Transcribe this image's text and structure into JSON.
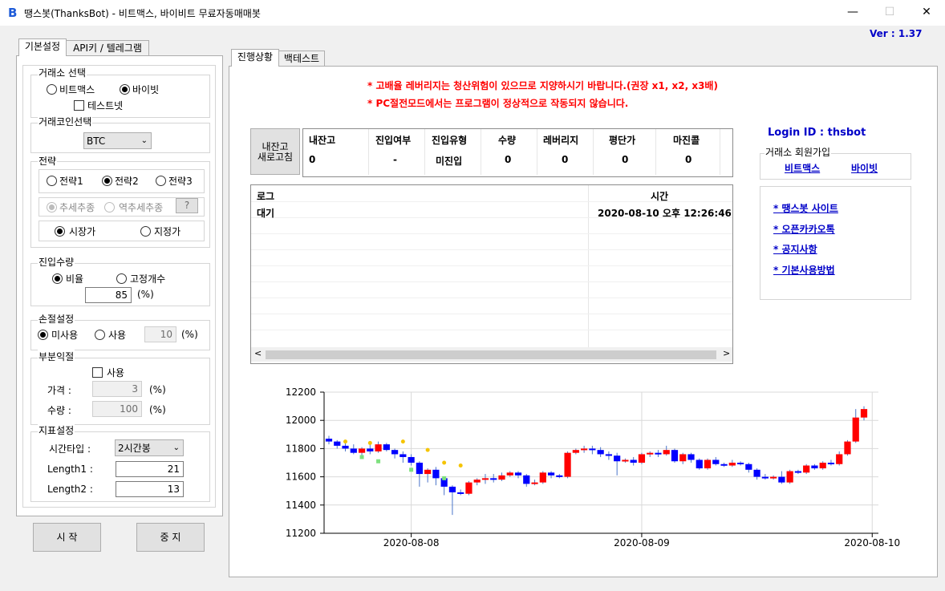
{
  "window": {
    "title": "땡스봇(ThanksBot) - 비트맥스, 바이비트 무료자동매매봇",
    "app_icon": "B",
    "minimize_glyph": "—",
    "maximize_glyph": "☐",
    "close_glyph": "✕",
    "version": "Ver :  1.37"
  },
  "left_tabs": [
    "기본설정",
    "API키 / 텔레그램"
  ],
  "exchange": {
    "title": "거래소 선택",
    "options": [
      "비트맥스",
      "바이빗"
    ],
    "selected": 1,
    "testnet_label": "테스트넷",
    "testnet_checked": false
  },
  "coin": {
    "title": "거래코인선택",
    "value": "BTC"
  },
  "strategy": {
    "title": "전략",
    "options": [
      "전략1",
      "전략2",
      "전략3"
    ],
    "selected": 1,
    "trend_options": [
      "추세추종",
      "역추세추종"
    ],
    "trend_selected": 0,
    "help_label": "?",
    "order_options": [
      "시장가",
      "지정가"
    ],
    "order_selected": 0
  },
  "entry_qty": {
    "title": "진입수량",
    "options": [
      "비율",
      "고정개수"
    ],
    "selected": 0,
    "value": "85",
    "unit": "(%)"
  },
  "stoploss": {
    "title": "손절설정",
    "options": [
      "미사용",
      "사용"
    ],
    "selected": 0,
    "value": "10",
    "unit": "(%)"
  },
  "partial": {
    "title": "부분익절",
    "use_label": "사용",
    "use_checked": false,
    "price_label": "가격 :",
    "price_value": "3",
    "qty_label": "수량 :",
    "qty_value": "100",
    "unit": "(%)"
  },
  "indicator": {
    "title": "지표설정",
    "timeframe_label": "시간타입 :",
    "timeframe_value": "2시간봉",
    "length1_label": "Length1 :",
    "length1_value": "21",
    "length2_label": "Length2 :",
    "length2_value": "13"
  },
  "buttons": {
    "start": "시 작",
    "stop": "중 지"
  },
  "right_tabs": [
    "진행상황",
    "백테스트"
  ],
  "warnings": [
    "* 고배율 레버리지는 청산위험이 있으므로 지양하시기 바랍니다.(권장 x1, x2, x3배)",
    "* PC절전모드에서는 프로그램이 정상적으로 작동되지 않습니다."
  ],
  "refresh_button": [
    "내잔고",
    "새로고침"
  ],
  "status_table": {
    "headers": [
      "내잔고",
      "진입여부",
      "진입유형",
      "수량",
      "레버리지",
      "평단가",
      "마진콜"
    ],
    "values": [
      "0",
      "-",
      "미진입",
      "0",
      "0",
      "0",
      "0"
    ]
  },
  "login": {
    "label": "Login ID :",
    "id": "thsbot"
  },
  "signup": {
    "title": "거래소 회원가입",
    "links": [
      "비트맥스",
      "바이빗"
    ]
  },
  "side_links": [
    "* 땡스봇 사이트",
    "* 오픈카카오톡",
    "* 공지사항",
    "* 기본사용방법"
  ],
  "log": {
    "headers": [
      "로그",
      "시간"
    ],
    "rows": [
      [
        "대기",
        "2020-08-10 오후 12:26:46"
      ]
    ],
    "scroll_left": "<",
    "scroll_right": ">"
  },
  "colors": {
    "up": "#ff0000",
    "down": "#0000ff",
    "link": "#0000c8",
    "warning": "#ff0000"
  },
  "chart_data": {
    "type": "candlestick",
    "ylim": [
      11200,
      12200
    ],
    "yticks": [
      11200,
      11400,
      11600,
      11800,
      12000,
      12200
    ],
    "xtick_labels": [
      "2020-08-08",
      "2020-08-09",
      "2020-08-10"
    ],
    "xtick_index": [
      10,
      38,
      66
    ],
    "grid": true,
    "candles": [
      [
        11870,
        11850,
        11890,
        11830
      ],
      [
        11850,
        11820,
        11860,
        11800
      ],
      [
        11820,
        11800,
        11840,
        11780
      ],
      [
        11800,
        11770,
        11830,
        11760
      ],
      [
        11770,
        11800,
        11810,
        11750
      ],
      [
        11800,
        11780,
        11830,
        11760
      ],
      [
        11780,
        11830,
        11850,
        11770
      ],
      [
        11830,
        11790,
        11840,
        11780
      ],
      [
        11790,
        11760,
        11800,
        11730
      ],
      [
        11760,
        11740,
        11780,
        11700
      ],
      [
        11740,
        11700,
        11760,
        11680
      ],
      [
        11700,
        11620,
        11710,
        11530
      ],
      [
        11620,
        11650,
        11660,
        11560
      ],
      [
        11650,
        11590,
        11670,
        11540
      ],
      [
        11590,
        11530,
        11600,
        11470
      ],
      [
        11530,
        11490,
        11540,
        11330
      ],
      [
        11490,
        11480,
        11510,
        11470
      ],
      [
        11480,
        11560,
        11570,
        11470
      ],
      [
        11560,
        11580,
        11590,
        11540
      ],
      [
        11580,
        11590,
        11620,
        11550
      ],
      [
        11590,
        11580,
        11620,
        11560
      ],
      [
        11580,
        11610,
        11630,
        11570
      ],
      [
        11610,
        11630,
        11640,
        11600
      ],
      [
        11630,
        11610,
        11640,
        11590
      ],
      [
        11610,
        11550,
        11620,
        11530
      ],
      [
        11550,
        11560,
        11580,
        11540
      ],
      [
        11560,
        11630,
        11640,
        11550
      ],
      [
        11630,
        11610,
        11640,
        11590
      ],
      [
        11610,
        11600,
        11620,
        11590
      ],
      [
        11600,
        11770,
        11780,
        11590
      ],
      [
        11770,
        11790,
        11800,
        11760
      ],
      [
        11790,
        11800,
        11820,
        11770
      ],
      [
        11800,
        11790,
        11820,
        11760
      ],
      [
        11790,
        11760,
        11810,
        11740
      ],
      [
        11760,
        11750,
        11780,
        11720
      ],
      [
        11750,
        11710,
        11770,
        11610
      ],
      [
        11710,
        11720,
        11730,
        11700
      ],
      [
        11720,
        11700,
        11740,
        11680
      ],
      [
        11700,
        11760,
        11770,
        11690
      ],
      [
        11760,
        11770,
        11780,
        11740
      ],
      [
        11770,
        11760,
        11790,
        11740
      ],
      [
        11760,
        11790,
        11820,
        11750
      ],
      [
        11790,
        11710,
        11800,
        11700
      ],
      [
        11710,
        11760,
        11770,
        11690
      ],
      [
        11760,
        11720,
        11770,
        11700
      ],
      [
        11720,
        11660,
        11730,
        11650
      ],
      [
        11660,
        11720,
        11730,
        11650
      ],
      [
        11720,
        11690,
        11740,
        11680
      ],
      [
        11690,
        11680,
        11700,
        11670
      ],
      [
        11680,
        11700,
        11720,
        11670
      ],
      [
        11700,
        11690,
        11710,
        11680
      ],
      [
        11690,
        11650,
        11700,
        11630
      ],
      [
        11650,
        11600,
        11660,
        11580
      ],
      [
        11600,
        11590,
        11620,
        11580
      ],
      [
        11590,
        11600,
        11610,
        11580
      ],
      [
        11600,
        11560,
        11640,
        11550
      ],
      [
        11560,
        11640,
        11650,
        11550
      ],
      [
        11640,
        11630,
        11650,
        11620
      ],
      [
        11630,
        11680,
        11690,
        11620
      ],
      [
        11680,
        11660,
        11690,
        11650
      ],
      [
        11660,
        11700,
        11710,
        11650
      ],
      [
        11700,
        11690,
        11720,
        11680
      ],
      [
        11690,
        11760,
        11780,
        11680
      ],
      [
        11760,
        11850,
        11860,
        11750
      ],
      [
        11850,
        12020,
        12080,
        11840
      ],
      [
        12020,
        12080,
        12100,
        12000
      ]
    ],
    "markers_yellow": [
      [
        2,
        11850
      ],
      [
        5,
        11840
      ],
      [
        9,
        11850
      ],
      [
        12,
        11790
      ],
      [
        14,
        11700
      ],
      [
        16,
        11680
      ]
    ],
    "markers_green": [
      [
        4,
        11740
      ],
      [
        6,
        11710
      ],
      [
        10,
        11650
      ],
      [
        14,
        11590
      ]
    ]
  }
}
